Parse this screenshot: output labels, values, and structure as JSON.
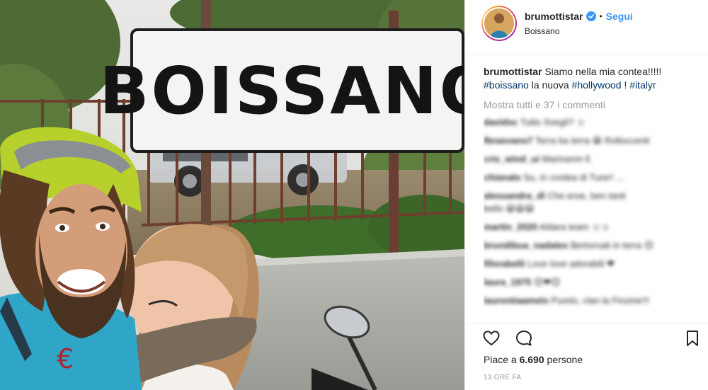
{
  "post": {
    "sign_text": "BOISSANO",
    "username": "brumottistar",
    "dot": "•",
    "follow_label": "Segui",
    "location": "Boissano",
    "caption": {
      "user": "brumottistar",
      "text": "Siamo nella mia contea!!!!!",
      "tag1": "#boissano",
      "mid": " la nuova ",
      "tag2": "#hollywood",
      "end": " ! ",
      "tag3": "#italyг"
    },
    "show_all_comments": "Mostra tutti e 37 i commenti",
    "blurred_comments": [
      {
        "user": "davidsc",
        "text": "Tutto Svegli? ☺"
      },
      {
        "user": "fbrasvano7",
        "text": "Terra ka terra 😁 Rolloccenti"
      },
      {
        "user": "cris_wind_ui",
        "text": "Marinanm ll."
      },
      {
        "user": "chianalo",
        "text": "Su, in contea di Turer! ..."
      },
      {
        "user": "alessandra_dl",
        "text": "Che eroe, ben tanti"
      },
      {
        "user": "",
        "text": "bello 😀😀😀"
      },
      {
        "user": "martin_2020",
        "text": "Aldara team ☺☺"
      },
      {
        "user": "brundibua_nadales",
        "text": "Bertornati in terra 😊"
      },
      {
        "user": "fiforabelli",
        "text": "Love love adorabili ❤"
      },
      {
        "user": "laura_1975",
        "text": "😊❤😊"
      },
      {
        "user": "laurentiaamelo",
        "text": "Purelo, clan la Finzine!!!"
      }
    ],
    "likes_prefix": "Piace a ",
    "likes_count": "6.690",
    "likes_suffix": " persone",
    "time": "13 ORE FA",
    "icons": {
      "like": "heart-icon",
      "comment": "comment-icon",
      "save": "bookmark-icon",
      "verified": "verified-badge-icon"
    },
    "colors": {
      "link": "#003569",
      "follow": "#3897f0",
      "muted": "#999999"
    }
  }
}
